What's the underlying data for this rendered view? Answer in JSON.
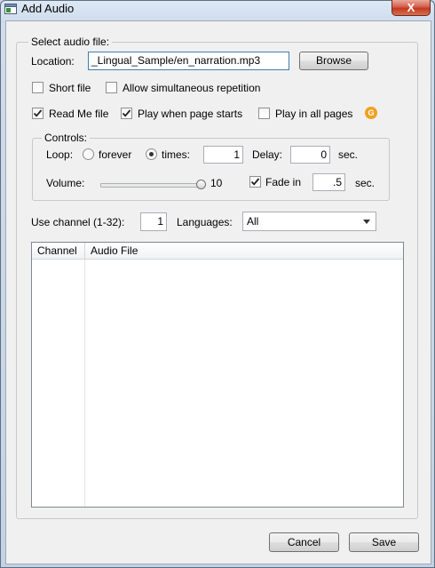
{
  "window": {
    "title": "Add Audio",
    "close_glyph": "X"
  },
  "select_group": {
    "legend": "Select audio file:",
    "location_label": "Location:",
    "location_value": "_Lingual_Sample/en_narration.mp3",
    "browse_label": "Browse",
    "short_file": {
      "label": "Short file",
      "checked": false
    },
    "allow_repetition": {
      "label": "Allow simultaneous repetition",
      "checked": false
    },
    "read_me_file": {
      "label": "Read Me file",
      "checked": true
    },
    "play_when_page_starts": {
      "label": "Play when page starts",
      "checked": true
    },
    "play_in_all_pages": {
      "label": "Play in all pages",
      "checked": false
    },
    "info_badge": "G"
  },
  "controls": {
    "legend": "Controls:",
    "loop_label": "Loop:",
    "forever_label": "forever",
    "times_label": "times:",
    "loop_mode": "times",
    "times_value": "1",
    "delay_label": "Delay:",
    "delay_value": "0",
    "delay_unit": "sec.",
    "volume_label": "Volume:",
    "volume_value": "10",
    "volume_fraction": 1.0,
    "fade_in": {
      "label": "Fade in",
      "checked": true
    },
    "fade_value": ".5",
    "fade_unit": "sec."
  },
  "channel": {
    "label": "Use channel (1-32):",
    "value": "1",
    "languages_label": "Languages:",
    "languages_selected": "All"
  },
  "table": {
    "columns": [
      "Channel",
      "Audio File"
    ],
    "rows": []
  },
  "footer": {
    "cancel_label": "Cancel",
    "save_label": "Save"
  }
}
